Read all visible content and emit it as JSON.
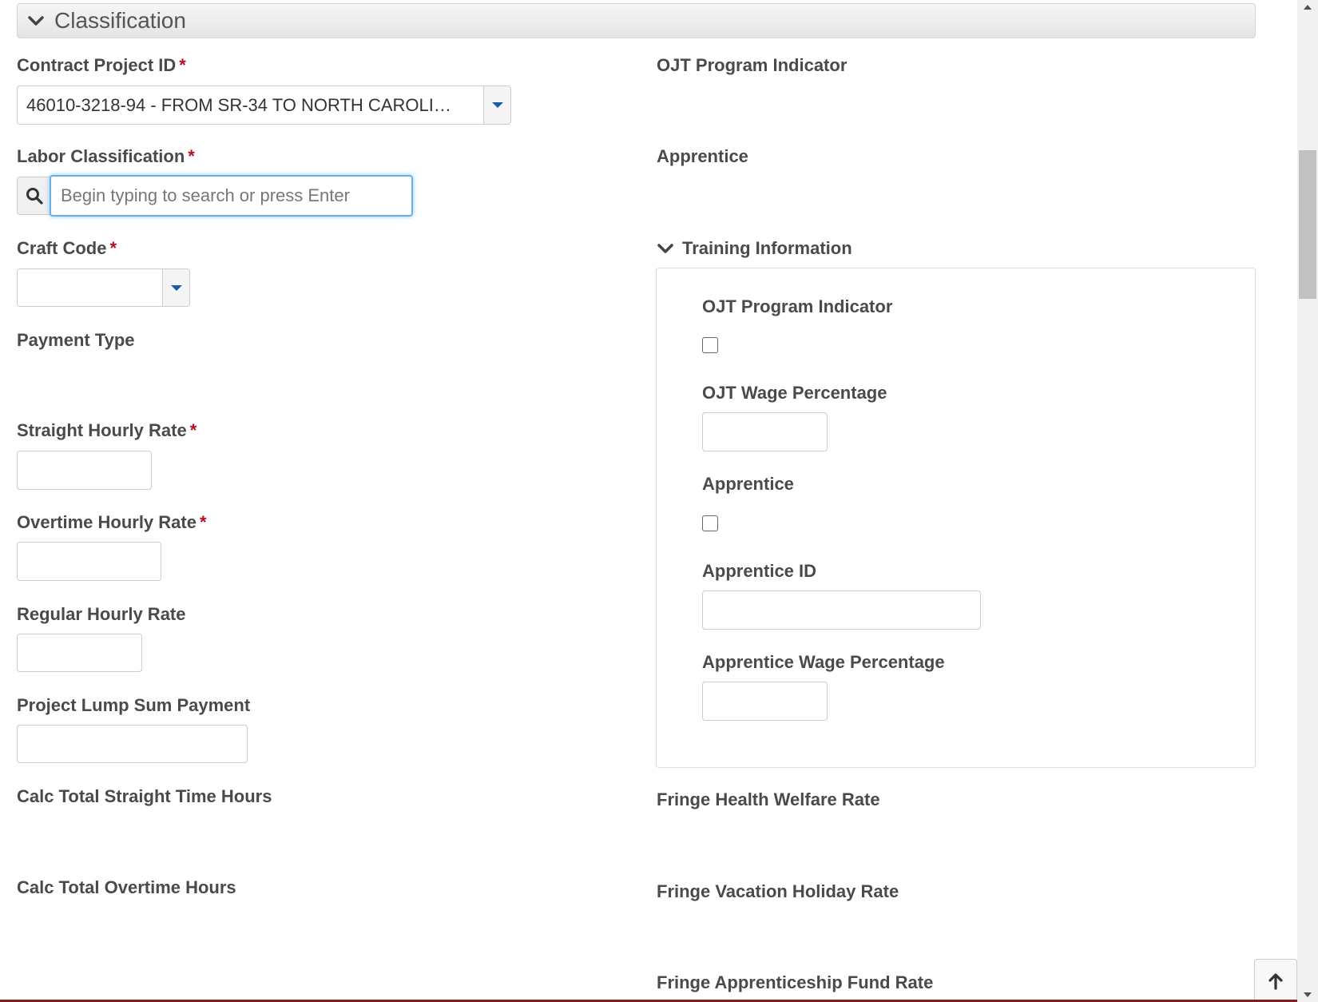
{
  "section": {
    "title": "Classification"
  },
  "left": {
    "contract_project_id": {
      "label": "Contract Project ID",
      "required_mark": "*",
      "value": "46010-3218-94 - FROM SR-34 TO NORTH CAROLI…"
    },
    "labor_classification": {
      "label": "Labor Classification",
      "required_mark": "*",
      "placeholder": "Begin typing to search or press Enter"
    },
    "craft_code": {
      "label": "Craft Code",
      "required_mark": "*",
      "value": ""
    },
    "payment_type": {
      "label": "Payment Type"
    },
    "straight_hourly_rate": {
      "label": "Straight Hourly Rate",
      "required_mark": "*"
    },
    "overtime_hourly_rate": {
      "label": "Overtime Hourly Rate",
      "required_mark": "*"
    },
    "regular_hourly_rate": {
      "label": "Regular Hourly Rate"
    },
    "project_lump_sum_payment": {
      "label": "Project Lump Sum Payment"
    },
    "calc_total_straight_time_hours": {
      "label": "Calc Total Straight Time Hours"
    },
    "calc_total_overtime_hours": {
      "label": "Calc Total Overtime Hours"
    }
  },
  "right": {
    "ojt_program_indicator": {
      "label": "OJT Program Indicator"
    },
    "apprentice": {
      "label": "Apprentice"
    },
    "training_information": {
      "title": "Training Information",
      "ojt_program_indicator": {
        "label": "OJT Program Indicator",
        "checked": false
      },
      "ojt_wage_percentage": {
        "label": "OJT Wage Percentage"
      },
      "apprentice": {
        "label": "Apprentice",
        "checked": false
      },
      "apprentice_id": {
        "label": "Apprentice ID"
      },
      "apprentice_wage_percentage": {
        "label": "Apprentice Wage Percentage"
      }
    },
    "fringe_health_welfare_rate": {
      "label": "Fringe Health Welfare Rate"
    },
    "fringe_vacation_holiday_rate": {
      "label": "Fringe Vacation Holiday Rate"
    },
    "fringe_apprenticeship_fund_rate": {
      "label": "Fringe Apprenticeship Fund Rate"
    }
  },
  "icons": {
    "section_toggle": "chevron-down-icon",
    "search": "search-icon",
    "dropdown": "caret-down-icon",
    "back_to_top": "arrow-up-icon"
  },
  "colors": {
    "required": "#b3111b",
    "focus": "#66afe9",
    "dropdown_caret": "#1a5aa6",
    "label": "#4a4a4a"
  }
}
